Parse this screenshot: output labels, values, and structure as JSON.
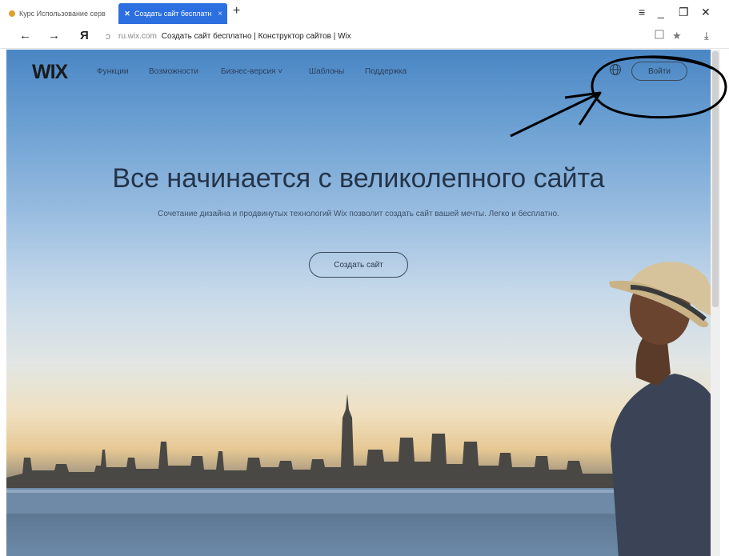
{
  "browser": {
    "tabs": [
      {
        "label": "Курс Использование серв"
      },
      {
        "label": "Создать сайт бесплатн"
      }
    ],
    "address": {
      "domain": "ru.wix.com",
      "title": "Создать сайт бесплатно | Конструктор сайтов | Wix"
    },
    "controls": {
      "back": "←",
      "forward": "→",
      "yandex": "Я",
      "reload": "ↄ",
      "new_tab": "+",
      "menu": "≡",
      "minimize": "_",
      "restore": "❐",
      "close": "✕",
      "bookmark": "★",
      "download": "⤓"
    }
  },
  "page": {
    "logo": "WIX",
    "nav": [
      {
        "label": "Функции"
      },
      {
        "label": "Возможности"
      },
      {
        "label": "Бизнес-версия ˅"
      },
      {
        "label": "Шаблоны"
      },
      {
        "label": "Поддержка"
      }
    ],
    "login_label": "Войти",
    "headline": "Все начинается с великолепного сайта",
    "subline": "Сочетание дизайна и продвинутых технологий Wix позволит создать сайт вашей мечты. Легко и бесплатно.",
    "cta_label": "Создать сайт"
  },
  "icons": [
    "globe-icon",
    "star-icon",
    "download-icon",
    "tab-close-icon"
  ],
  "colors": {
    "tab_active": "#2b6fe0",
    "headline": "#243449",
    "annotation": "#000000"
  }
}
